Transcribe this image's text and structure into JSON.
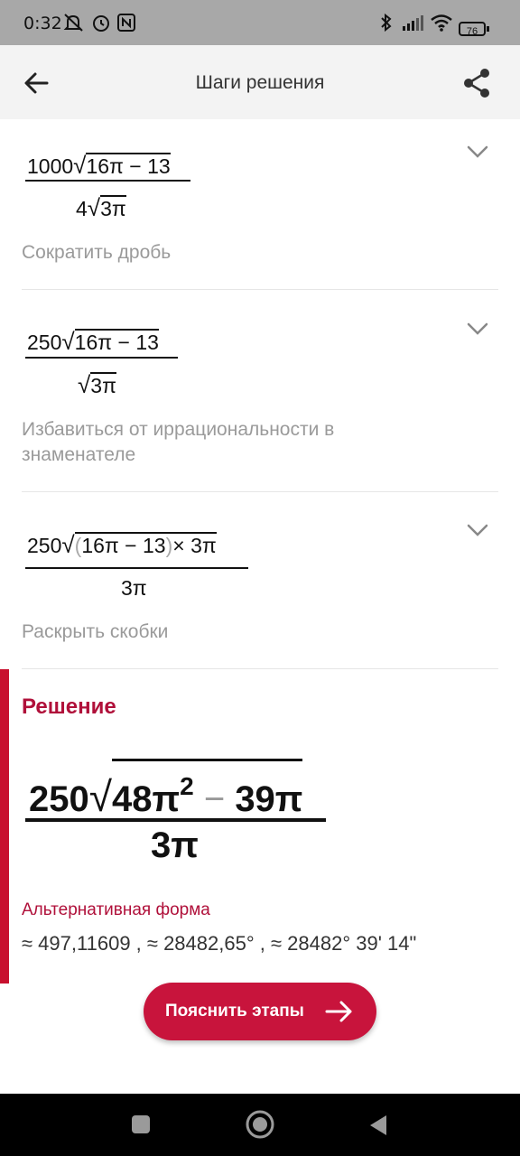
{
  "status_bar": {
    "time": "0:32",
    "battery": "76"
  },
  "app_bar": {
    "title": "Шаги решения"
  },
  "steps": [
    {
      "numerator": {
        "coef": "1000",
        "radicand": "16π − 13"
      },
      "denominator": {
        "coef": "4",
        "radicand": "3π"
      },
      "label": "Сократить дробь"
    },
    {
      "numerator": {
        "coef": "250",
        "radicand": "16π − 13"
      },
      "denominator": {
        "coef": "",
        "radicand": "3π"
      },
      "label": "Избавиться от иррациональности в знаменателе"
    },
    {
      "numerator": {
        "coef": "250",
        "radicand_open": "(",
        "radicand_inner": "16π − 13",
        "radicand_close": ")",
        "radicand_rest": "× 3π"
      },
      "denominator": {
        "value": "3π"
      },
      "label": "Раскрыть скобки"
    }
  ],
  "solution": {
    "title": "Решение",
    "numerator": {
      "coef": "250",
      "term1": "48π",
      "exponent": "2",
      "minus": "−",
      "term2": "39π"
    },
    "denominator": "3π",
    "alt_title": "Альтернативная форма",
    "alt_values": "≈ 497,11609 , ≈ 28482,65° , ≈ 28482° 39' 14\""
  },
  "explain_button": {
    "label": "Пояснить этапы"
  },
  "colors": {
    "accent": "#c8143c",
    "status_bar": "#a8a8a8",
    "app_bar": "#f3f3f3"
  },
  "icons": [
    "back-arrow-icon",
    "share-icon",
    "chevron-down-icon",
    "arrow-right-icon",
    "nav-recents-icon",
    "nav-home-icon",
    "nav-back-icon"
  ]
}
